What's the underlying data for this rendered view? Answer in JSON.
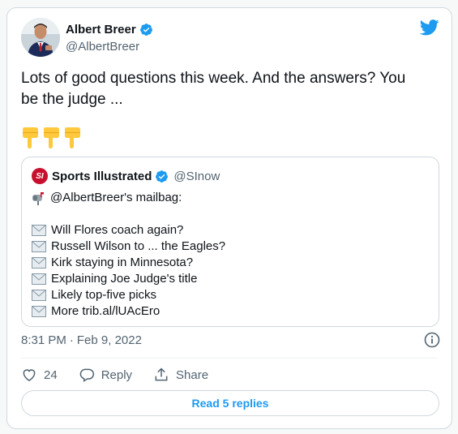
{
  "author": {
    "display_name": "Albert Breer",
    "handle": "@AlbertBreer",
    "verified": true,
    "avatar_icon": "avatar-photo"
  },
  "brand": {
    "icon": "twitter-bird-icon",
    "color": "#1d9bf0"
  },
  "tweet": {
    "text": "Lots of good questions this week. And the answers? You be the judge ...",
    "emojis": [
      "point-down",
      "point-down",
      "point-down"
    ]
  },
  "quote": {
    "logo_text": "SI",
    "display_name": "Sports Illustrated",
    "handle": "@SInow",
    "verified": true,
    "intro": "@AlbertBreer's mailbag:",
    "items": [
      "Will Flores coach again?",
      "Russell Wilson to ... the Eagles?",
      "Kirk staying in Minnesota?",
      "Explaining Joe Judge's title",
      "Likely top-five picks",
      "More trib.al/lUAcEro"
    ]
  },
  "meta": {
    "time": "8:31 PM",
    "separator": "·",
    "date": "Feb 9, 2022"
  },
  "actions": {
    "like_count": "24",
    "reply_label": "Reply",
    "share_label": "Share"
  },
  "replies_button": "Read 5 replies",
  "colors": {
    "verified": "#1d9bf0",
    "si_red": "#c8102e",
    "muted": "#536471",
    "border": "#cfd9de",
    "emoji": "#ffc83d"
  }
}
